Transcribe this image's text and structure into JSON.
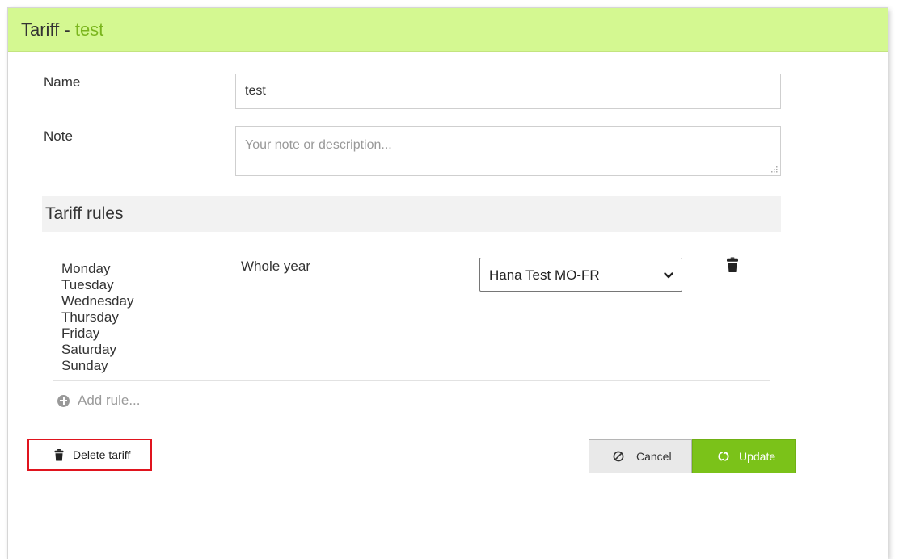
{
  "header": {
    "prefix": "Tariff - ",
    "tariff_name": "test"
  },
  "form": {
    "name_label": "Name",
    "name_value": "test",
    "note_label": "Note",
    "note_placeholder": "Your note or description..."
  },
  "rules": {
    "title": "Tariff rules",
    "items": [
      {
        "days": [
          "Monday",
          "Tuesday",
          "Wednesday",
          "Thursday",
          "Friday",
          "Saturday",
          "Sunday"
        ],
        "period": "Whole year",
        "selected_tariff": "Hana Test MO-FR"
      }
    ],
    "add_rule_label": "Add rule..."
  },
  "actions": {
    "delete_label": "Delete tariff",
    "cancel_label": "Cancel",
    "update_label": "Update"
  },
  "colors": {
    "header_bg": "#d4f891",
    "tariff_name_color": "#7ab51d",
    "update_bg": "#7bc219",
    "delete_border": "#e0141e"
  },
  "icons": {
    "rule_delete": "trash-icon",
    "add_rule": "plus-circle-icon",
    "delete_tariff": "trash-icon",
    "cancel": "ban-icon",
    "update": "refresh-icon",
    "select": "chevron-down-icon"
  }
}
